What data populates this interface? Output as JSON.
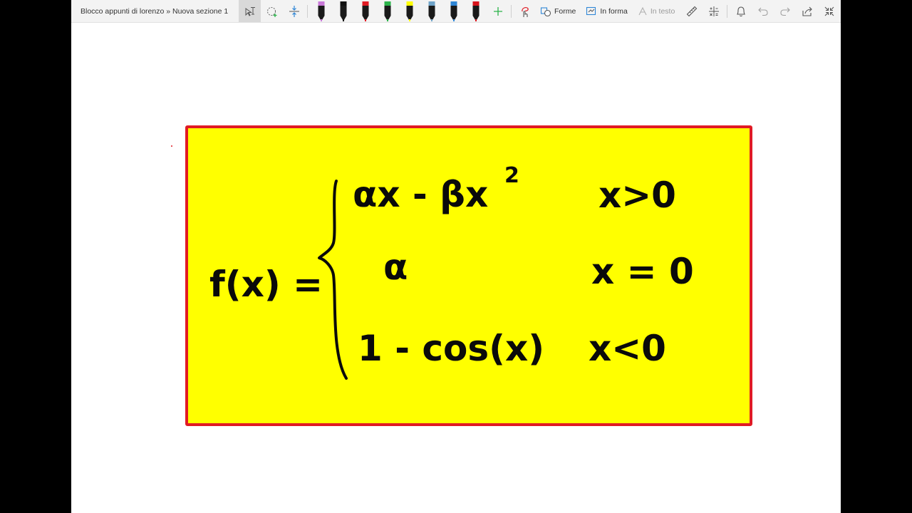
{
  "toolbar": {
    "breadcrumb": "Blocco appunti di lorenzo » Nuova sezione 1",
    "shapes_label": "Forme",
    "ink_to_shape_label": "In forma",
    "ink_to_text_label": "In testo",
    "pens": [
      {
        "name": "pen-purple",
        "color": "#c878d8"
      },
      {
        "name": "pen-black",
        "color": "#111111"
      },
      {
        "name": "pen-red",
        "color": "#e01b24"
      },
      {
        "name": "pen-green",
        "color": "#2bb34a"
      },
      {
        "name": "highlighter-yellow",
        "color": "#ffff00"
      },
      {
        "name": "pen-galaxy",
        "color": "#6fa3c8"
      },
      {
        "name": "pen-blue",
        "color": "#2f86d6"
      },
      {
        "name": "pen-red-2",
        "color": "#d8141c"
      }
    ]
  },
  "note": {
    "box_fill": "#ffff00",
    "box_border": "#e01b24",
    "lhs": "f(x) =",
    "cases": [
      {
        "expr": "αx - βx",
        "superscript": "2",
        "condition": "x>0"
      },
      {
        "expr": "α",
        "condition": "x = 0"
      },
      {
        "expr": "1 - cos(x)",
        "condition": "x<0"
      }
    ]
  }
}
